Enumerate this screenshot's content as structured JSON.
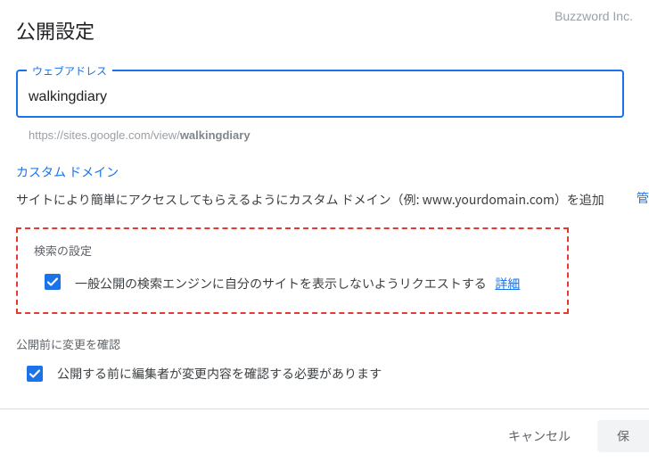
{
  "watermark": "Buzzword Inc.",
  "dialog": {
    "title": "公開設定"
  },
  "webAddress": {
    "label": "ウェブアドレス",
    "value": "walkingdiary",
    "previewPrefix": "https://sites.google.com/view/",
    "previewSlug": "walkingdiary"
  },
  "customDomain": {
    "link": "カスタム ドメイン",
    "description": "サイトにより簡単にアクセスしてもらえるようにカスタム ドメイン（例: www.yourdomain.com）を追加",
    "sideLink": "管"
  },
  "searchSettings": {
    "title": "検索の設定",
    "checkboxLabel": "一般公開の検索エンジンに自分のサイトを表示しないようリクエストする",
    "detailsLink": "詳細"
  },
  "reviewSettings": {
    "title": "公開前に変更を確認",
    "checkboxLabel": "公開する前に編集者が変更内容を確認する必要があります"
  },
  "buttons": {
    "cancel": "キャンセル",
    "save": "保"
  }
}
